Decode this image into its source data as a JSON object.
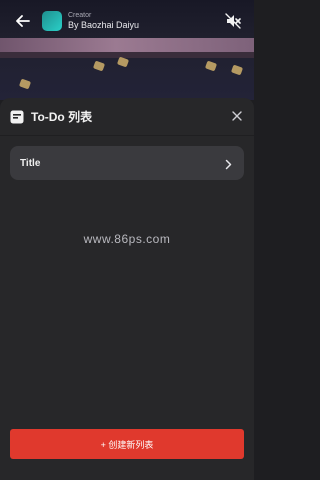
{
  "creator": {
    "caption": "Creator",
    "name": "By Baozhai Daiyu"
  },
  "panel": {
    "title": "To-Do 列表"
  },
  "lists": [
    {
      "title": "Title"
    }
  ],
  "watermark": "www.86ps.com",
  "actions": {
    "create_label": "+ 创建新列表"
  },
  "colors": {
    "panel_bg": "#272729",
    "card_bg": "#3a3a3e",
    "accent": "#e0392d"
  },
  "icons": [
    "back-arrow-icon",
    "mute-icon",
    "todo-list-icon",
    "close-icon",
    "chevron-right-icon"
  ]
}
